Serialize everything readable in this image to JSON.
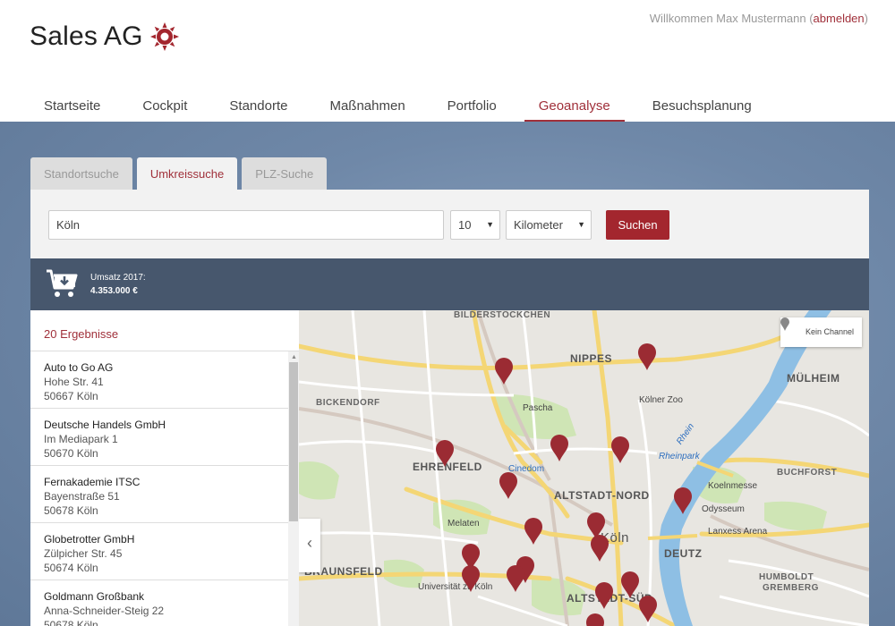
{
  "header": {
    "brand": "Sales AG",
    "welcome_prefix": "Willkommen Max Mustermann (",
    "logout": "abmelden",
    "welcome_suffix": ")"
  },
  "nav": [
    {
      "label": "Startseite",
      "active": false
    },
    {
      "label": "Cockpit",
      "active": false
    },
    {
      "label": "Standorte",
      "active": false
    },
    {
      "label": "Maßnahmen",
      "active": false
    },
    {
      "label": "Portfolio",
      "active": false
    },
    {
      "label": "Geoanalyse",
      "active": true
    },
    {
      "label": "Besuchsplanung",
      "active": false
    }
  ],
  "tabs": [
    {
      "label": "Standortsuche",
      "active": false
    },
    {
      "label": "Umkreissuche",
      "active": true
    },
    {
      "label": "PLZ-Suche",
      "active": false
    }
  ],
  "search": {
    "city_value": "Köln",
    "radius_value": "10",
    "unit_value": "Kilometer",
    "button": "Suchen"
  },
  "revenue": {
    "label": "Umsatz 2017:",
    "value": "4.353.000 €"
  },
  "results": {
    "count_label": "20 Ergebnisse",
    "items": [
      {
        "name": "Auto to Go AG",
        "street": "Hohe Str. 41",
        "city": "50667 Köln"
      },
      {
        "name": "Deutsche Handels GmbH",
        "street": "Im Mediapark 1",
        "city": "50670 Köln"
      },
      {
        "name": "Fernakademie ITSC",
        "street": "Bayenstraße 51",
        "city": "50678 Köln"
      },
      {
        "name": "Globetrotter GmbH",
        "street": "Zülpicher Str. 45",
        "city": "50674 Köln"
      },
      {
        "name": "Goldmann Großbank",
        "street": "Anna-Schneider-Steig 22",
        "city": "50678 Köln"
      }
    ]
  },
  "map": {
    "channel_label": "Kein Channel",
    "labels": {
      "bilderstoeckchen": "BILDERSTÖCKCHEN",
      "nippes": "NIPPES",
      "muelheim": "MÜLHEIM",
      "bickendorf": "BICKENDORF",
      "pascha": "Pascha",
      "koelner_zoo": "Kölner Zoo",
      "ehrenfeld": "EHRENFELD",
      "cinedom": "Cinedom",
      "altstadt_nord": "ALTSTADT-NORD",
      "rheinpark": "Rheinpark",
      "buchforst": "BUCHFORST",
      "koelnmesse": "Koelnmesse",
      "odysseum": "Odysseum",
      "melaten": "Melaten",
      "koeln": "Köln",
      "lanxess": "Lanxess Arena",
      "deutz": "DEUTZ",
      "braunsfeld": "BRAUNSFELD",
      "universitaet": "Universität zu Köln",
      "altstadt_sued": "ALTSTADT-SÜD",
      "humboldt": "HUMBOLDT",
      "gremberg": "GREMBERG",
      "rhein": "Rhein"
    },
    "marker_color": "#9b2b33"
  }
}
